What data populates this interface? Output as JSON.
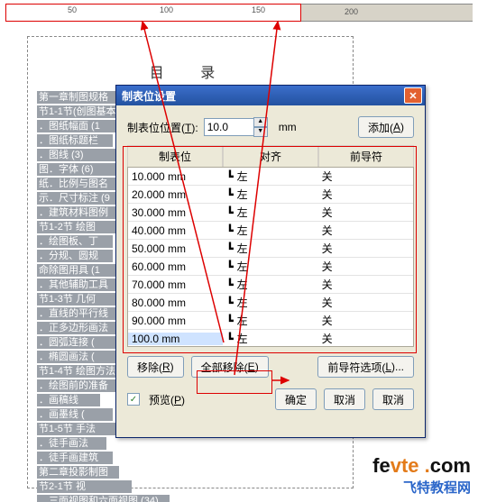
{
  "ruler": {
    "labels": [
      "50",
      "100",
      "150",
      "200"
    ]
  },
  "doc": {
    "title": "目  录",
    "lines": [
      "第一章制图规格",
      "节1-1节(创图基本)",
      "．图纸幅面 (1",
      "．图纸标题栏",
      "．图线 (3)",
      "图．字体 (6)",
      "纸．比例与图名",
      "示．尺寸标注 (9",
      "．建筑材料图例",
      "节1-2节  绘图",
      "．绘图板、丁",
      "．分规、圆规",
      "命除图用具 (1",
      "．其他辅助工具",
      "节1-3节   几何",
      "．直线的平行线",
      "．正多边形画法",
      "．圆弧连接 (",
      "．椭圆画法 (",
      "节1-4节 绘图方法",
      "．绘图前的准备",
      "．画稿线",
      "．画墨线 (",
      "节1-5节 手法",
      "．徒手画法",
      "．徒手画建筑",
      "第二章投影制图",
      "节2-1节   视",
      "．三面视图和六面视图 (34)"
    ]
  },
  "dialog": {
    "title": "制表位设置",
    "posLabelA": "制表位位置(",
    "posLabelU": "T",
    "posLabelB": "):",
    "posValue": "10.0",
    "unit": "mm",
    "addA": "添加(",
    "addU": "A",
    "addB": ")",
    "headers": {
      "c0": "制表位",
      "c1": "对齐",
      "c2": "前导符"
    },
    "rows": [
      {
        "pos": "10.000 mm",
        "align": "左",
        "lead": "关"
      },
      {
        "pos": "20.000 mm",
        "align": "左",
        "lead": "关"
      },
      {
        "pos": "30.000 mm",
        "align": "左",
        "lead": "关"
      },
      {
        "pos": "40.000 mm",
        "align": "左",
        "lead": "关"
      },
      {
        "pos": "50.000 mm",
        "align": "左",
        "lead": "关"
      },
      {
        "pos": "60.000 mm",
        "align": "左",
        "lead": "关"
      },
      {
        "pos": "70.000 mm",
        "align": "左",
        "lead": "关"
      },
      {
        "pos": "80.000 mm",
        "align": "左",
        "lead": "关"
      },
      {
        "pos": "90.000 mm",
        "align": "左",
        "lead": "关"
      },
      {
        "pos": "100.0 mm",
        "align": "左",
        "lead": "关"
      }
    ],
    "removeA": "移除(",
    "removeU": "R",
    "removeB": ")",
    "removeAllA": "全部移除(",
    "removeAllU": "E",
    "removeAllB": ")",
    "leadOptA": "前导符选项(",
    "leadOptU": "L",
    "leadOptB": ")...",
    "previewA": "预览(",
    "previewU": "P",
    "previewB": ")",
    "ok": "确定",
    "cancel": "取消",
    "cancel2": "取消",
    "checked": "✓"
  },
  "brand": {
    "fe": "fe",
    "vte": "vte",
    "dot": " .",
    "com": "com",
    "sub": "飞特教程网"
  }
}
